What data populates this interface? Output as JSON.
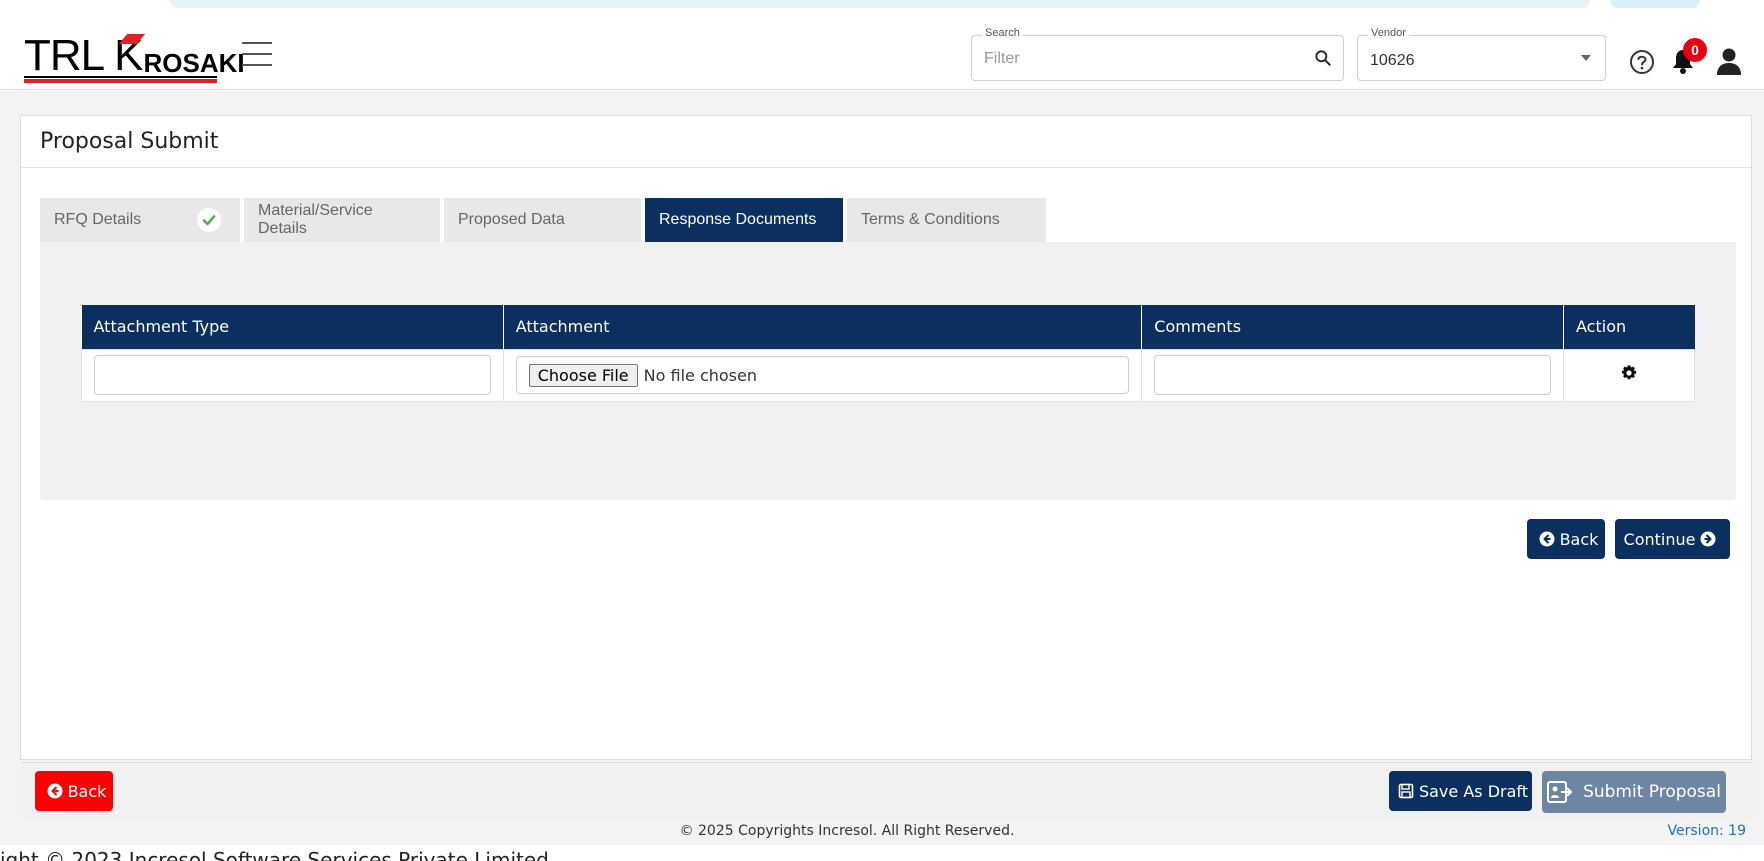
{
  "header": {
    "logo_primary": "TRL",
    "logo_k": "K",
    "logo_secondary": "ROSAKI",
    "search": {
      "label": "Search",
      "placeholder": "Filter"
    },
    "vendor": {
      "label": "Vendor",
      "value": "10626"
    },
    "notification_count": "0",
    "icons": [
      "hamburger-icon",
      "search-icon",
      "chevron-down-icon",
      "help-icon",
      "bell-icon",
      "user-icon"
    ]
  },
  "page": {
    "title": "Proposal Submit"
  },
  "tabs": [
    {
      "label": "RFQ Details",
      "completed": true,
      "active": false
    },
    {
      "label": "Material/Service Details",
      "completed": false,
      "active": false
    },
    {
      "label": "Proposed Data",
      "completed": false,
      "active": false
    },
    {
      "label": "Response Documents",
      "completed": false,
      "active": true
    },
    {
      "label": "Terms & Conditions",
      "completed": false,
      "active": false
    }
  ],
  "attachments_table": {
    "columns": [
      "Attachment Type",
      "Attachment",
      "Comments",
      "Action"
    ],
    "rows": [
      {
        "attachment_type": "",
        "choose_file_label": "Choose File",
        "file_status": "No file chosen",
        "comments": ""
      }
    ]
  },
  "navigation": {
    "back_label": "Back",
    "continue_label": "Continue"
  },
  "footer_actions": {
    "back_label": "Back",
    "save_draft_label": "Save As Draft",
    "submit_label": "Submit Proposal"
  },
  "footer": {
    "copyright": "© 2025 Copyrights Incresol. All Right Reserved.",
    "version": "Version: 19",
    "bottom_cut_text": "ight © 2023 Incresol Software Services Private Limited"
  },
  "colors": {
    "navy": "#0b2f5e",
    "danger": "#ff0000",
    "submit_disabled": "#6e85a3",
    "badge": "#e60012",
    "success_check": "#4caf50",
    "version_link": "#1a6fd0"
  }
}
